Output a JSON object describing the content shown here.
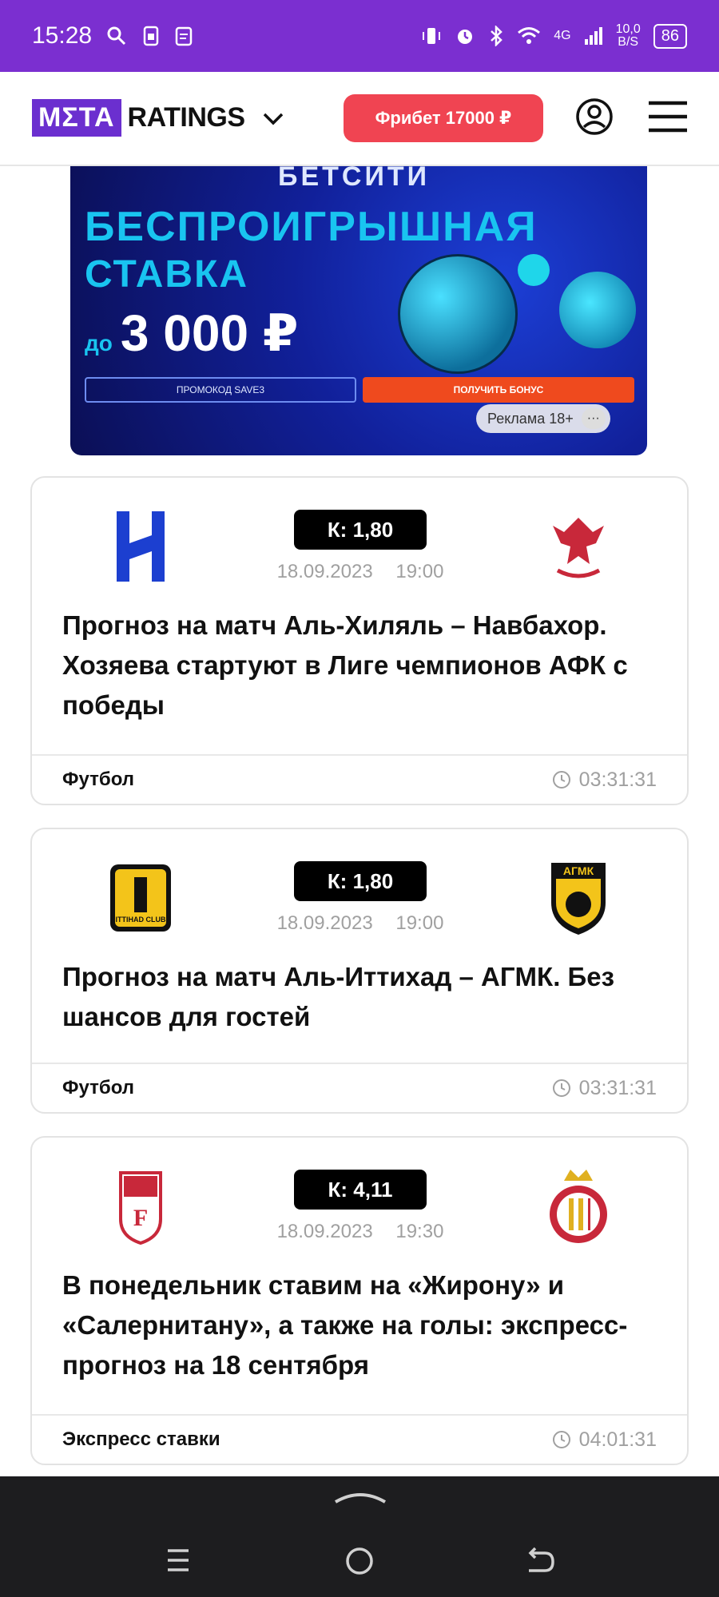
{
  "status_bar": {
    "time": "15:28",
    "network": "4G",
    "speed_top": "10,0",
    "speed_bottom": "B/S",
    "battery": "86"
  },
  "header": {
    "logo_meta": "MΣTA",
    "logo_ratings": "RATINGS",
    "freebet_label": "Фрибет 17000 ₽"
  },
  "banner": {
    "brand": "БЕТСИТИ",
    "title_line1": "БЕСПРОИГРЫШНАЯ",
    "title_line2": "СТАВКА",
    "amount_prefix": "до",
    "amount": "3 000 ₽",
    "promo_label": "ПРОМОКОД SAVE3",
    "cta_label": "ПОЛУЧИТЬ БОНУС",
    "ad_badge": "Реклама 18+",
    "ad_more": "···"
  },
  "cards": [
    {
      "odds": "К: 1,80",
      "date": "18.09.2023",
      "time": "19:00",
      "title": "Прогноз на матч Аль-Хиляль – Навбахор. Хозяева стартуют в Лиге чемпионов АФК с победы",
      "category": "Футбол",
      "countdown": "03:31:31"
    },
    {
      "odds": "К: 1,80",
      "date": "18.09.2023",
      "time": "19:00",
      "title": "Прогноз на матч Аль-Иттихад – АГМК. Без шансов для гостей",
      "category": "Футбол",
      "countdown": "03:31:31",
      "away_logo_text": "АГМК",
      "home_logo_text": "ITTIHAD CLUB"
    },
    {
      "odds": "К: 4,11",
      "date": "18.09.2023",
      "time": "19:30",
      "title": "В понедельник ставим на «Жирону» и «Салернитану», а также на голы: экспресс-прогноз на 18 сентября",
      "category": "Экспресс ставки",
      "countdown": "04:01:31"
    }
  ],
  "colors": {
    "status_bar": "#7b2fd0",
    "logo": "#6b2fcf",
    "freebet": "#f04452",
    "odds_badge": "#000000",
    "nav_bar": "#1d1d1f"
  },
  "icons": [
    "search-icon",
    "sim-icon",
    "clipboard-icon",
    "vibrate-icon",
    "alarm-icon",
    "bluetooth-icon",
    "wifi-icon",
    "signal-icon",
    "chevron-down-icon",
    "profile-icon",
    "menu-icon",
    "clock-icon",
    "nav-menu-icon",
    "nav-home-icon",
    "nav-back-icon"
  ]
}
